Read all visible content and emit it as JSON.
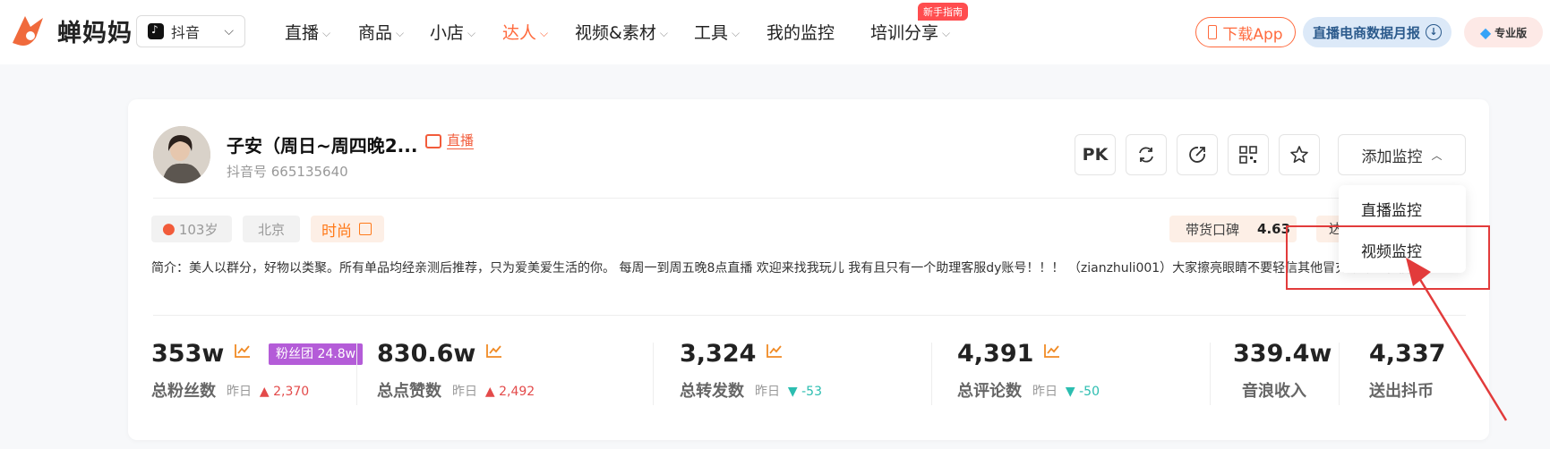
{
  "brand": {
    "name": "蝉妈妈",
    "color": "#ff6a3d"
  },
  "platform": {
    "value": "抖音",
    "icon": "tiktok-icon"
  },
  "nav": [
    {
      "label": "直播",
      "has_menu": true
    },
    {
      "label": "商品",
      "has_menu": true
    },
    {
      "label": "小店",
      "has_menu": true
    },
    {
      "label": "达人",
      "has_menu": true,
      "active": true
    },
    {
      "label": "视频&素材",
      "has_menu": true
    },
    {
      "label": "工具",
      "has_menu": true
    },
    {
      "label": "我的监控",
      "has_menu": false
    },
    {
      "label": "培训分享",
      "has_menu": true,
      "badge": "新手指南"
    }
  ],
  "header_actions": {
    "download_app": "下载App",
    "report": "直播电商数据月报",
    "pro": "专业版"
  },
  "profile": {
    "name": "子安（周日~周四晚2...",
    "live_tag": "直播",
    "douyin_id": "抖音号 665135640",
    "tags": {
      "age": "103岁",
      "city": "北京",
      "category": "时尚"
    },
    "reputation_label": "带货口碑",
    "reputation_value": "4.63",
    "reputation2_label": "达",
    "bio": "简介：美人以群分，好物以类聚。所有单品均经亲测后推荐，只为爱美爱生活的你。 每周一到周五晚8点直播 欢迎来找我玩儿 我有且只有一个助理客服dy账号！！！ （zianzhuli001）大家擦亮眼睛不要轻信其他冒充账号的私信！"
  },
  "toolbar": {
    "pk_label": "PK",
    "add_monitor_label": "添加监控"
  },
  "dropdown": {
    "items": [
      "直播监控",
      "视频监控"
    ],
    "highlighted": "视频监控"
  },
  "stats": {
    "yesterday_label": "昨日",
    "fans": {
      "value": "353w",
      "label": "总粉丝数",
      "delta": "2,370",
      "direction": "up",
      "fan_club": "粉丝团 24.8w"
    },
    "likes": {
      "value": "830.6w",
      "label": "总点赞数",
      "delta": "2,492",
      "direction": "up"
    },
    "shares": {
      "value": "3,324",
      "label": "总转发数",
      "delta": "-53",
      "direction": "down"
    },
    "comments": {
      "value": "4,391",
      "label": "总评论数",
      "delta": "-50",
      "direction": "down"
    },
    "income": {
      "value": "339.4w",
      "label": "音浪收入"
    },
    "coins": {
      "value": "4,337",
      "label": "送出抖币"
    }
  },
  "colors": {
    "up": "#e34a4a",
    "down": "#2bbdb0",
    "annotation": "#e23b3b",
    "fan_club": "#b45cd8"
  }
}
